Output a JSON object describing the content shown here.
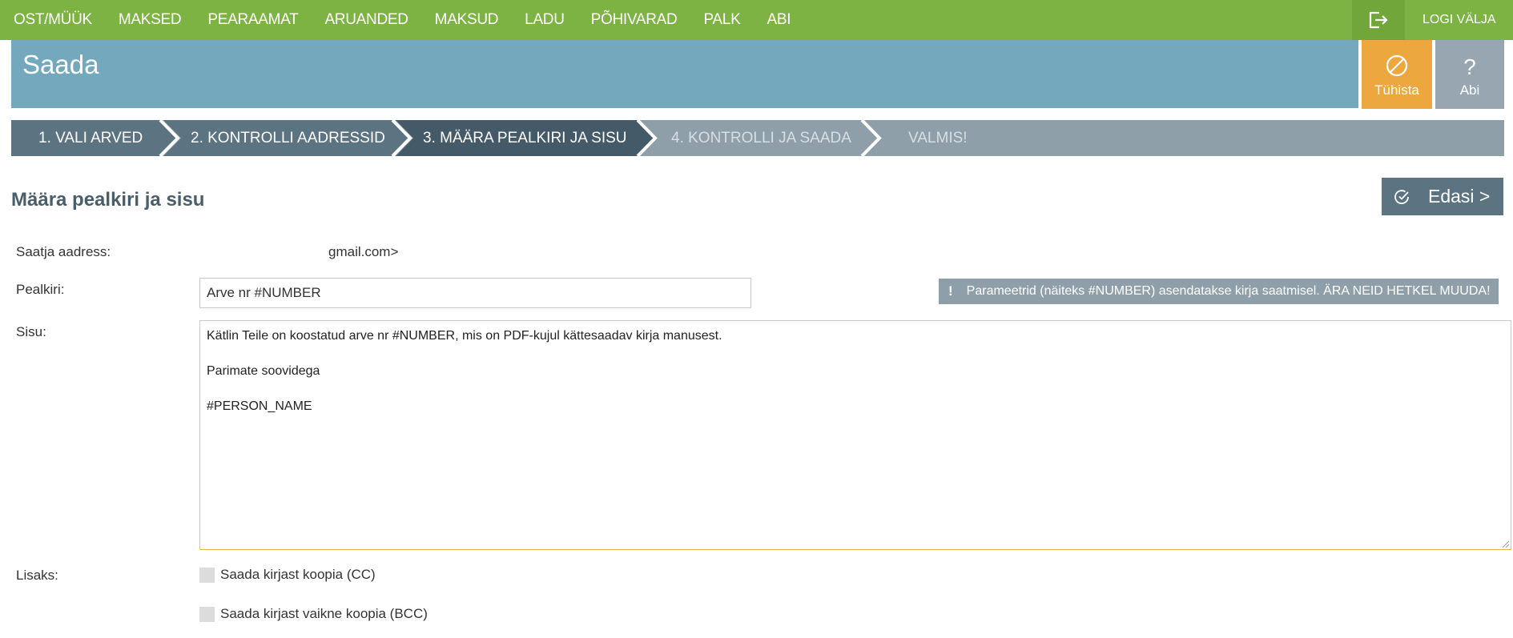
{
  "nav": {
    "items": [
      "OST/MÜÜK",
      "MAKSED",
      "PEARAAMAT",
      "ARUANDED",
      "MAKSUD",
      "LADU",
      "PÕHIVARAD",
      "PALK",
      "ABI"
    ],
    "logout_icon": "logout-icon",
    "logout_label": "LOGI VÄLJA"
  },
  "header": {
    "title": "Saada",
    "cancel_label": "Tühista",
    "cancel_icon": "ban-icon",
    "help_label": "Abi",
    "help_icon": "question-icon"
  },
  "steps": [
    {
      "label": "1. VALI ARVED",
      "state": "done"
    },
    {
      "label": "2. KONTROLLI AADRESSID",
      "state": "done"
    },
    {
      "label": "3. MÄÄRA PEALKIRI JA SISU",
      "state": "active"
    },
    {
      "label": "4. KONTROLLI JA SAADA",
      "state": "todo"
    },
    {
      "label": "VALMIS!",
      "state": "todo"
    }
  ],
  "section": {
    "title": "Määra pealkiri ja sisu",
    "next_label": "Edasi >",
    "next_icon": "check-circle-icon"
  },
  "form": {
    "sender_label": "Saatja aadress:",
    "sender_value": "gmail.com>",
    "subject_label": "Pealkiri:",
    "subject_value": "Arve nr #NUMBER",
    "notice_icon": "exclamation-icon",
    "notice": "Parameetrid (näiteks #NUMBER) asendatakse kirja saatmisel. ÄRA NEID HETKEL MUUDA!",
    "body_label": "Sisu:",
    "body_lines": [
      "Kätlin Teile on koostatud arve nr #NUMBER, mis on PDF-kujul kättesaadav kirja manusest.",
      "Parimate soovidega",
      "#PERSON_NAME"
    ],
    "extras_label": "Lisaks:",
    "cc_label": "Saada kirjast koopia (CC)",
    "cc_checked": false,
    "bcc_label": "Saada kirjast vaikne koopia (BCC)",
    "bcc_checked": false
  },
  "colors": {
    "nav_green": "#7cb342",
    "title_blue": "#74a8bd",
    "cancel_orange": "#eca73f",
    "step_active": "#455a68",
    "step_done": "#5c7482",
    "step_todo": "#8f9fa9"
  }
}
